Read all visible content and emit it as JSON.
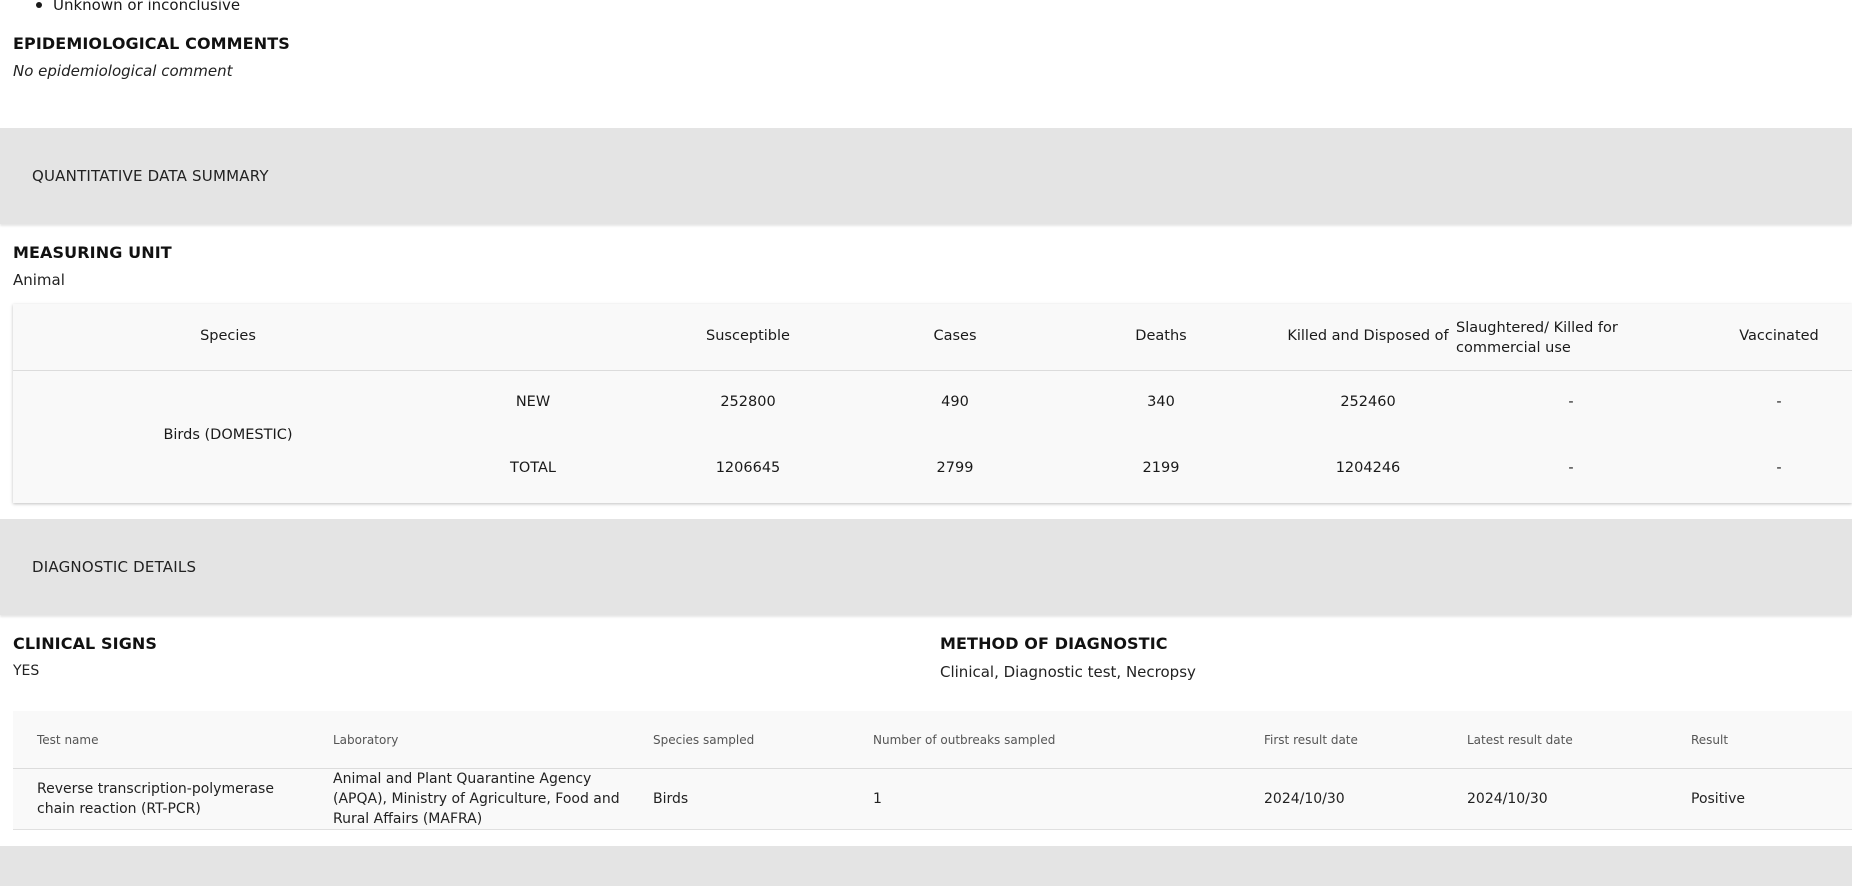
{
  "top_bullet": "Unknown or inconclusive",
  "epidemiological": {
    "heading": "EPIDEMIOLOGICAL COMMENTS",
    "value": "No epidemiological comment"
  },
  "quantitative_band": "QUANTITATIVE DATA SUMMARY",
  "measuring_unit": {
    "heading": "MEASURING UNIT",
    "value": "Animal"
  },
  "quant_table": {
    "headers": {
      "species": "Species",
      "susceptible": "Susceptible",
      "cases": "Cases",
      "deaths": "Deaths",
      "killed": "Killed and Disposed of",
      "slaughtered": "Slaughtered/ Killed for commercial use",
      "vaccinated": "Vaccinated"
    },
    "species": "Birds (DOMESTIC)",
    "rows": [
      {
        "label": "NEW",
        "susceptible": "252800",
        "cases": "490",
        "deaths": "340",
        "killed": "252460",
        "slaughtered": "-",
        "vaccinated": "-"
      },
      {
        "label": "TOTAL",
        "susceptible": "1206645",
        "cases": "2799",
        "deaths": "2199",
        "killed": "1204246",
        "slaughtered": "-",
        "vaccinated": "-"
      }
    ]
  },
  "diagnostic_band": "DIAGNOSTIC DETAILS",
  "clinical_signs": {
    "heading": "CLINICAL SIGNS",
    "value": "YES"
  },
  "method": {
    "heading": "METHOD OF DIAGNOSTIC",
    "value": "Clinical, Diagnostic test, Necropsy"
  },
  "test_table": {
    "headers": {
      "test_name": "Test name",
      "laboratory": "Laboratory",
      "species_sampled": "Species sampled",
      "outbreaks": "Number of outbreaks sampled",
      "first_date": "First result date",
      "latest_date": "Latest result date",
      "result": "Result"
    },
    "rows": [
      {
        "test_name": "Reverse transcription-polymerase chain reaction (RT-PCR)",
        "laboratory": "Animal and Plant Quarantine Agency (APQA), Ministry of Agriculture, Food and Rural Affairs (MAFRA)",
        "species_sampled": "Birds",
        "outbreaks": "1",
        "first_date": "2024/10/30",
        "latest_date": "2024/10/30",
        "result": "Positive"
      }
    ]
  }
}
